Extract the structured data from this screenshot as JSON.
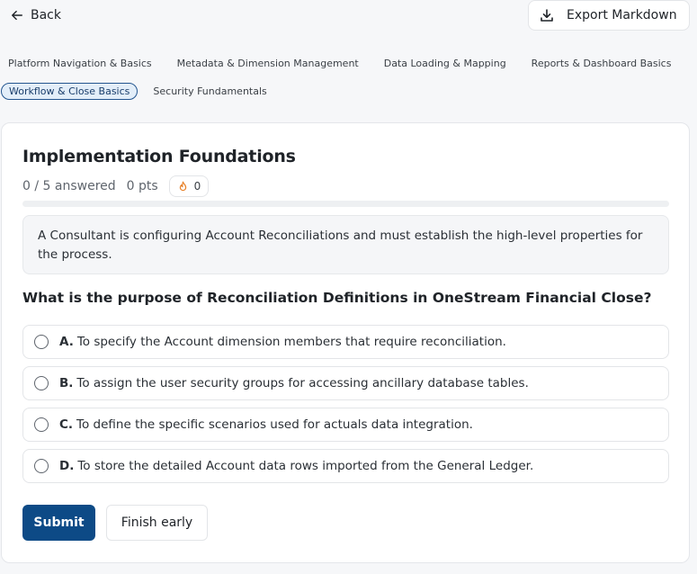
{
  "header": {
    "back_label": "Back",
    "export_label": "Export Markdown"
  },
  "tabs": [
    {
      "label": "Platform Navigation & Basics",
      "active": false
    },
    {
      "label": "Metadata & Dimension Management",
      "active": false
    },
    {
      "label": "Data Loading & Mapping",
      "active": false
    },
    {
      "label": "Reports & Dashboard Basics",
      "active": false
    },
    {
      "label": "Workflow & Close Basics",
      "active": true
    },
    {
      "label": "Security Fundamentals",
      "active": false
    }
  ],
  "quiz": {
    "title": "Implementation Foundations",
    "answered": "0 / 5 answered",
    "points": "0 pts",
    "streak": "0",
    "progress_fraction": 0,
    "context": "A Consultant is configuring Account Reconciliations and must establish the high-level properties for the process.",
    "question": "What is the purpose of Reconciliation Definitions in OneStream Financial Close?",
    "options": [
      {
        "letter": "A.",
        "text": "To specify the Account dimension members that require reconciliation."
      },
      {
        "letter": "B.",
        "text": "To assign the user security groups for accessing ancillary database tables."
      },
      {
        "letter": "C.",
        "text": "To define the specific scenarios used for actuals data integration."
      },
      {
        "letter": "D.",
        "text": "To store the detailed Account data rows imported from the General Ledger."
      }
    ],
    "submit_label": "Submit",
    "finish_label": "Finish early"
  },
  "colors": {
    "accent": "#0d4a86",
    "active_tab_bg": "#e3eef9",
    "active_tab_border": "#23558f",
    "streak_icon": "#e8822a"
  },
  "icons": {
    "back": "arrow-left-icon",
    "export": "download-icon",
    "streak": "flame-icon"
  }
}
